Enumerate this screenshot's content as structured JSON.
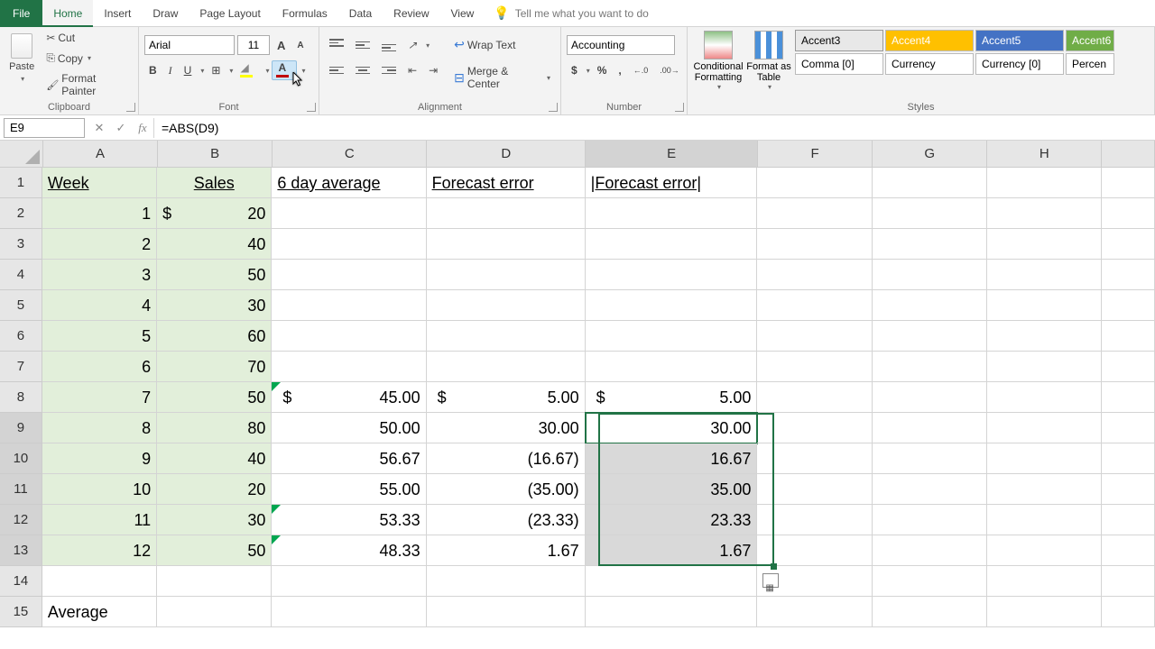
{
  "tabs": {
    "file": "File",
    "home": "Home",
    "insert": "Insert",
    "draw": "Draw",
    "page_layout": "Page Layout",
    "formulas": "Formulas",
    "data": "Data",
    "review": "Review",
    "view": "View",
    "tell_me": "Tell me what you want to do"
  },
  "ribbon": {
    "clipboard": {
      "label": "Clipboard",
      "paste": "Paste",
      "cut": "Cut",
      "copy": "Copy",
      "format_painter": "Format Painter"
    },
    "font": {
      "label": "Font",
      "name": "Arial",
      "size": "11",
      "bold": "B",
      "italic": "I",
      "underline": "U"
    },
    "alignment": {
      "label": "Alignment",
      "wrap": "Wrap Text",
      "merge": "Merge & Center"
    },
    "number": {
      "label": "Number",
      "format": "Accounting"
    },
    "styles": {
      "label": "Styles",
      "cond": "Conditional Formatting",
      "table": "Format as Table",
      "acc3": "Accent3",
      "acc4": "Accent4",
      "acc5": "Accent5",
      "acc6": "Accent6",
      "comma": "Comma [0]",
      "currency": "Currency",
      "currency0": "Currency [0]",
      "percent": "Percen"
    }
  },
  "formula_bar": {
    "reference": "E9",
    "formula": "=ABS(D9)"
  },
  "columns": [
    "A",
    "B",
    "C",
    "D",
    "E",
    "F",
    "G",
    "H"
  ],
  "chart_data": {
    "type": "table",
    "headers": {
      "A": "Week",
      "B": "Sales",
      "C": "6 day average",
      "D": "Forecast error",
      "E": "|Forecast error|"
    },
    "rows": [
      {
        "week": "1",
        "sales_sym": "$",
        "sales": "20"
      },
      {
        "week": "2",
        "sales": "40"
      },
      {
        "week": "3",
        "sales": "50"
      },
      {
        "week": "4",
        "sales": "30"
      },
      {
        "week": "5",
        "sales": "60"
      },
      {
        "week": "6",
        "sales": "70"
      },
      {
        "week": "7",
        "sales": "50",
        "avg_sym": "$",
        "avg": "45.00",
        "err_sym": "$",
        "err": "5.00",
        "abs_sym": "$",
        "abs": "5.00"
      },
      {
        "week": "8",
        "sales": "80",
        "avg": "50.00",
        "err": "30.00",
        "abs": "30.00"
      },
      {
        "week": "9",
        "sales": "40",
        "avg": "56.67",
        "err": "(16.67)",
        "abs": "16.67"
      },
      {
        "week": "10",
        "sales": "20",
        "avg": "55.00",
        "err": "(35.00)",
        "abs": "35.00"
      },
      {
        "week": "11",
        "sales": "30",
        "avg": "53.33",
        "err": "(23.33)",
        "abs": "23.33"
      },
      {
        "week": "12",
        "sales": "50",
        "avg": "48.33",
        "err": "1.67",
        "abs": "1.67"
      }
    ],
    "footer": {
      "label": "Average"
    }
  }
}
